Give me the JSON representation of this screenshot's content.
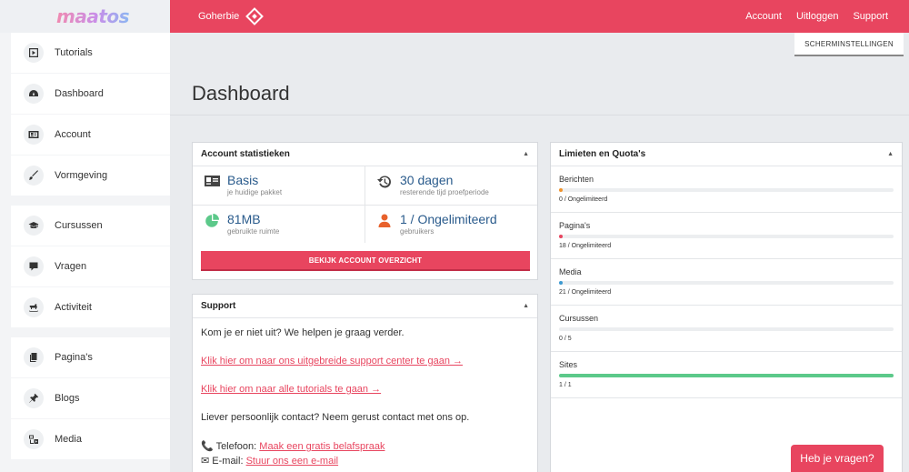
{
  "app": {
    "logo": "maatos",
    "site_name": "Goherbie"
  },
  "topnav": [
    {
      "label": "Account"
    },
    {
      "label": "Uitloggen"
    },
    {
      "label": "Support"
    }
  ],
  "screen_options_label": "SCHERMINSTELLINGEN",
  "sidebar": {
    "items": [
      {
        "label": "Tutorials",
        "icon": "play-icon"
      },
      {
        "label": "Dashboard",
        "icon": "speedometer-icon"
      },
      {
        "label": "Account",
        "icon": "id-card-icon"
      },
      {
        "label": "Vormgeving",
        "icon": "brush-icon"
      },
      {
        "label": "Cursussen",
        "icon": "graduation-cap-icon"
      },
      {
        "label": "Vragen",
        "icon": "chat-bubble-icon"
      },
      {
        "label": "Activiteit",
        "icon": "rocking-horse-icon"
      },
      {
        "label": "Pagina's",
        "icon": "copy-icon"
      },
      {
        "label": "Blogs",
        "icon": "pin-icon"
      },
      {
        "label": "Media",
        "icon": "media-icon"
      }
    ]
  },
  "page_title": "Dashboard",
  "account_stats": {
    "title": "Account statistieken",
    "stats": [
      {
        "value": "Basis",
        "sub": "je huidige pakket",
        "icon": "id-card-icon"
      },
      {
        "value": "30 dagen",
        "sub": "resterende tijd proefperiode",
        "icon": "history-icon"
      },
      {
        "value": "81MB",
        "sub": "gebruikte ruimte",
        "icon": "pie-chart-icon"
      },
      {
        "value": "1 / Ongelimiteerd",
        "sub": "gebruikers",
        "icon": "user-icon"
      }
    ],
    "cta_label": "BEKIJK ACCOUNT OVERZICHT"
  },
  "support": {
    "title": "Support",
    "intro": "Kom je er niet uit? We helpen je graag verder.",
    "link1": "Klik hier om naar ons uitgebreide support center te gaan →",
    "link2": "Klik hier om naar alle tutorials te gaan →",
    "personal": "Liever persoonlijk contact? Neem gerust contact met ons op.",
    "phone_label": "Telefoon:",
    "phone_link": "Maak een gratis belafspraak",
    "email_label": "E-mail:",
    "email_link": "Stuur ons een e-mail"
  },
  "limits": {
    "title": "Limieten en Quota's",
    "items": [
      {
        "label": "Berichten",
        "value": "0 / Ongelimiteerd",
        "fill": 0.01,
        "color": "#f0932b"
      },
      {
        "label": "Pagina's",
        "value": "18 / Ongelimiteerd",
        "fill": 0.01,
        "color": "#e8455f"
      },
      {
        "label": "Media",
        "value": "21 / Ongelimiteerd",
        "fill": 0.01,
        "color": "#3d9ad1"
      },
      {
        "label": "Cursussen",
        "value": "0 / 5",
        "fill": 0,
        "color": "#5cc98a"
      },
      {
        "label": "Sites",
        "value": "1 / 1",
        "fill": 1,
        "color": "#5cc98a"
      }
    ]
  },
  "help_button_label": "Heb je vragen?",
  "colors": {
    "accent": "#e8455f",
    "link_blue": "#2a5b8c",
    "success": "#5cc98a"
  }
}
